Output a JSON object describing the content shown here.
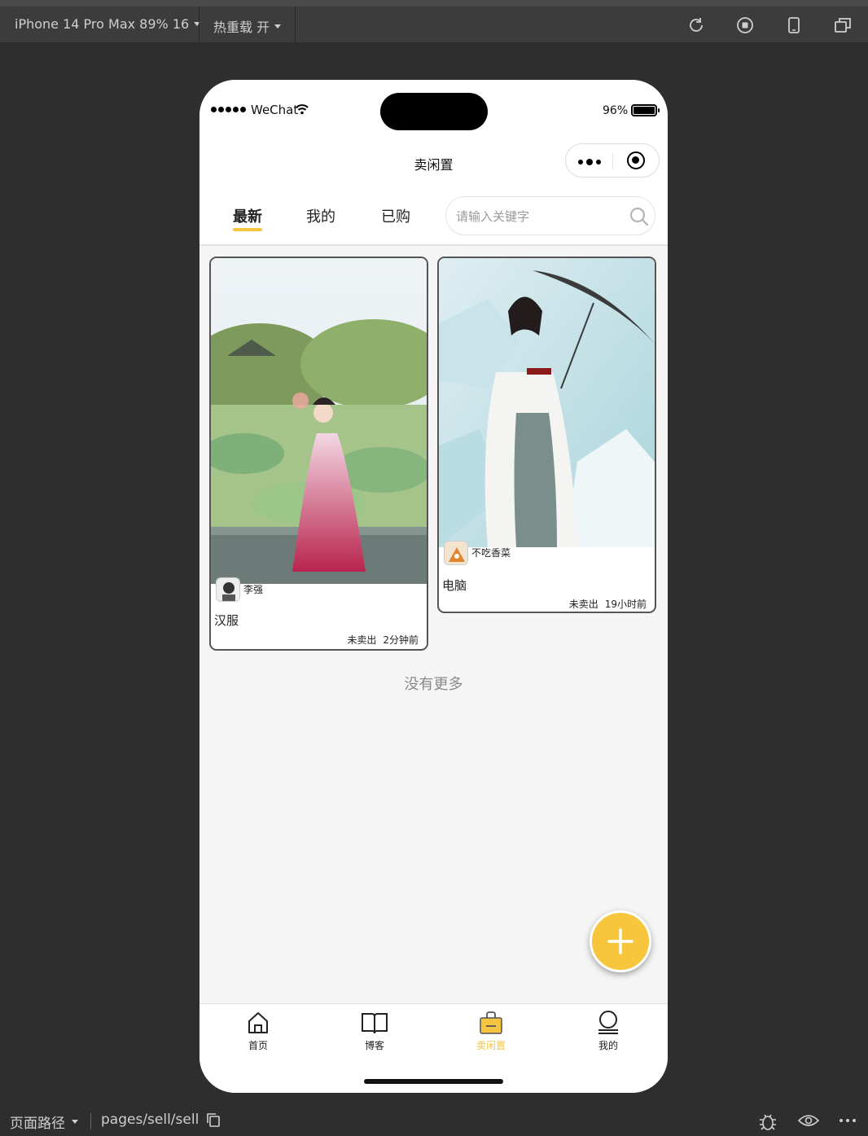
{
  "devtools": {
    "device_label": "iPhone 14 Pro Max 89% 16",
    "hot_reload_label": "热重载 开"
  },
  "status_bar": {
    "carrier": "WeChat",
    "battery_pct": "96%"
  },
  "nav": {
    "title": "卖闲置"
  },
  "tabs": [
    {
      "label": "最新",
      "active": true
    },
    {
      "label": "我的",
      "active": false
    },
    {
      "label": "已购",
      "active": false
    }
  ],
  "search": {
    "placeholder": "请输入关键字",
    "value": ""
  },
  "cards": [
    {
      "author": "李强",
      "title": "汉服",
      "status": "未卖出",
      "time": "2分钟前"
    },
    {
      "author": "不吃香菜",
      "title": "电脑",
      "status": "未卖出",
      "time": "19小时前"
    }
  ],
  "list_footer": "没有更多",
  "bottom_tabs": [
    {
      "label": "首页",
      "icon": "home-icon",
      "active": false
    },
    {
      "label": "博客",
      "icon": "book-icon",
      "active": false
    },
    {
      "label": "卖闲置",
      "icon": "shopping-bag-icon",
      "active": true
    },
    {
      "label": "我的",
      "icon": "user-icon",
      "active": false
    }
  ],
  "footer": {
    "path_label": "页面路径",
    "path_value": "pages/sell/sell"
  },
  "colors": {
    "accent": "#f5c542",
    "fab": "#f7c63c"
  }
}
